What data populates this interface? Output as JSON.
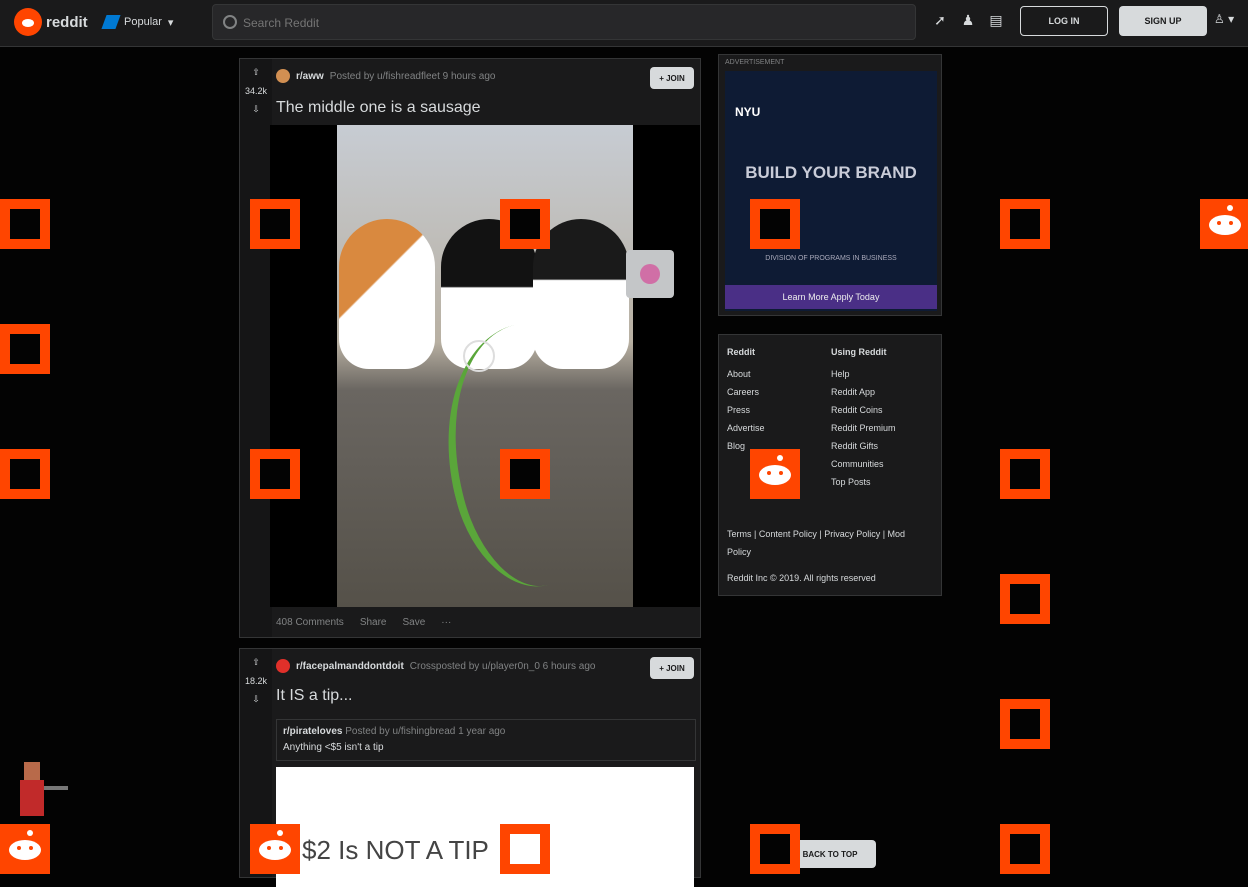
{
  "header": {
    "logo_text": "reddit",
    "community": "Popular",
    "search_placeholder": "Search Reddit",
    "login": "LOG IN",
    "signup": "SIGN UP"
  },
  "posts": [
    {
      "votes": "34.2k",
      "subreddit": "r/aww",
      "posted_by": "Posted by u/fishreadfleet 9 hours ago",
      "join": "+ JOIN",
      "title": "The middle one is a sausage",
      "actions": [
        "408 Comments",
        "Share",
        "Save"
      ]
    },
    {
      "votes": "18.2k",
      "subreddit": "r/facepalmanddontdoit",
      "posted_by": "Crossposted by u/player0n_0 6 hours ago",
      "join": "+ JOIN",
      "title": "It IS a tip...",
      "quote_user": "r/pirateloves",
      "quote_posted_by": "Posted by u/fishingbread 1 year ago",
      "quote_text": "Anything <$5 isn't a tip",
      "tweet_text": "$2 Is NOT A TIP"
    }
  ],
  "sidebar": {
    "ad_label": "ADVERTISEMENT",
    "ad_brand": "NYU",
    "ad_headline": "BUILD YOUR BRAND",
    "ad_sub": "DIVISION OF PROGRAMS IN BUSINESS",
    "ad_button": "Learn More Apply Today",
    "footer_col1": [
      "Reddit",
      "About",
      "Careers",
      "Press",
      "Advertise",
      "Blog"
    ],
    "footer_col2": [
      "Using Reddit",
      "Help",
      "Reddit App",
      "Reddit Coins",
      "Reddit Premium",
      "Reddit Gifts",
      "Communities",
      "Top Posts"
    ],
    "legal": "Terms | Content Policy | Privacy Policy | Mod Policy",
    "copyright": "Reddit Inc © 2019. All rights reserved",
    "back_to_top": "BACK TO TOP"
  },
  "colors": {
    "accent": "#ff4500",
    "bg": "#030303",
    "card": "#1a1a1b"
  }
}
